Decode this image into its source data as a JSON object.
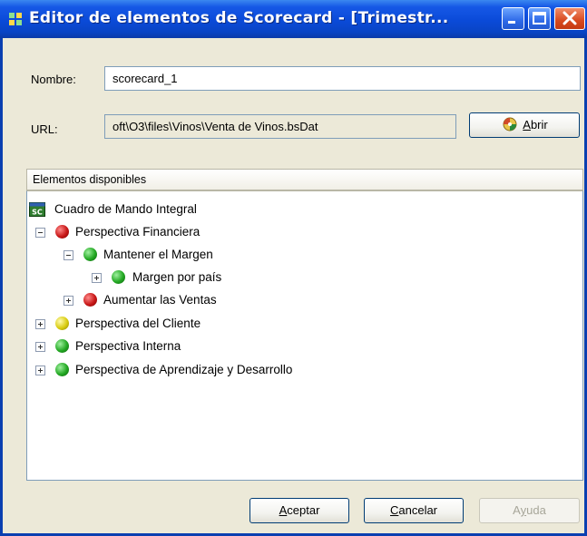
{
  "window": {
    "title": "Editor de elementos de Scorecard - [Trimestr...",
    "accent": "#0a4ad8"
  },
  "form": {
    "name_label": "Nombre:",
    "name_value": "scorecard_1",
    "url_label": "URL:",
    "url_value": "oft\\O3\\files\\Vinos\\Venta de Vinos.bsDat",
    "open_button": {
      "prefix": "",
      "mnemonic": "A",
      "rest": "brir",
      "icon": "open-globe-icon"
    }
  },
  "panel": {
    "header": "Elementos disponibles"
  },
  "tree": {
    "root": {
      "icon": "scorecard-icon",
      "icon_text": "SC",
      "label": "Cuadro de Mando Integral"
    },
    "items": [
      {
        "label": "Perspectiva Financiera",
        "status": "red",
        "expanded": true
      },
      {
        "label": "Mantener el Margen",
        "status": "green",
        "expanded": true
      },
      {
        "label": "Margen por país",
        "status": "green",
        "expanded": false
      },
      {
        "label": "Aumentar las Ventas",
        "status": "red",
        "expanded": false
      },
      {
        "label": "Perspectiva del Cliente",
        "status": "yellow",
        "expanded": false
      },
      {
        "label": "Perspectiva Interna",
        "status": "green",
        "expanded": false
      },
      {
        "label": "Perspectiva de Aprendizaje y Desarrollo",
        "status": "green",
        "expanded": false
      }
    ]
  },
  "footer": {
    "accept": {
      "prefix": "",
      "mnemonic": "A",
      "rest": "ceptar"
    },
    "cancel": {
      "prefix": "",
      "mnemonic": "C",
      "rest": "ancelar"
    },
    "help": {
      "prefix": "A",
      "mnemonic": "y",
      "rest": "uda",
      "disabled": true
    }
  },
  "status_colors": {
    "red": "#c81818",
    "green": "#23a823",
    "yellow": "#d9cc10"
  }
}
